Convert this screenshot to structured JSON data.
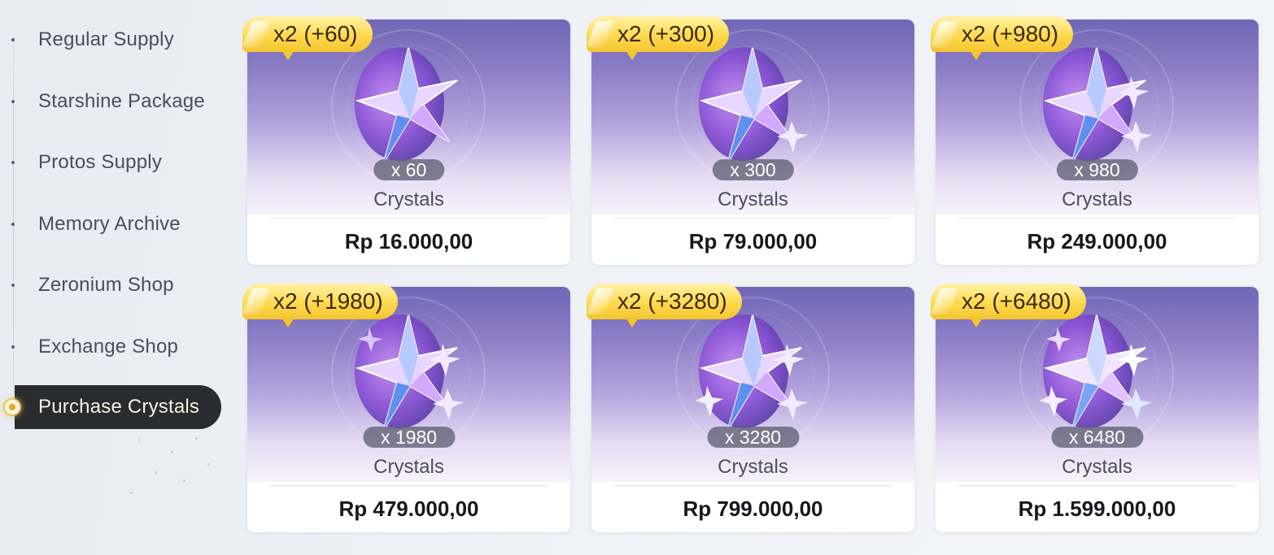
{
  "sidebar": {
    "items": [
      {
        "label": "Regular Supply"
      },
      {
        "label": "Starshine Package"
      },
      {
        "label": "Protos Supply"
      },
      {
        "label": "Memory Archive"
      },
      {
        "label": "Zeronium Shop"
      },
      {
        "label": "Exchange Shop"
      },
      {
        "label": "Purchase Crystals"
      }
    ],
    "active_item": "Purchase Crystals"
  },
  "products": [
    {
      "bonus": "x2 (+60)",
      "quantity": "x 60",
      "name": "Crystals",
      "price": "Rp 16.000,00"
    },
    {
      "bonus": "x2 (+300)",
      "quantity": "x 300",
      "name": "Crystals",
      "price": "Rp 79.000,00"
    },
    {
      "bonus": "x2 (+980)",
      "quantity": "x 980",
      "name": "Crystals",
      "price": "Rp 249.000,00"
    },
    {
      "bonus": "x2 (+1980)",
      "quantity": "x 1980",
      "name": "Crystals",
      "price": "Rp 479.000,00"
    },
    {
      "bonus": "x2 (+3280)",
      "quantity": "x 3280",
      "name": "Crystals",
      "price": "Rp 799.000,00"
    },
    {
      "bonus": "x2 (+6480)",
      "quantity": "x 6480",
      "name": "Crystals",
      "price": "Rp 1.599.000,00"
    }
  ],
  "colors": {
    "active_nav_bg": "#2a2b2e",
    "bonus_tag": "#ffd94d",
    "card_art_top": "#7067b6"
  },
  "icons": {
    "product_art": "crystal-cluster-icon",
    "active_marker": "selected-indicator-icon"
  }
}
